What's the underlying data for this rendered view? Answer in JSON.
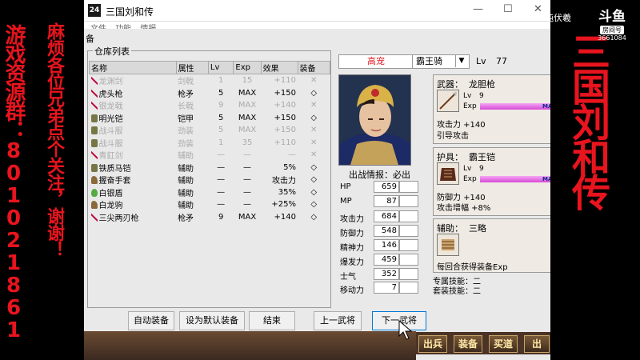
{
  "overlay": {
    "left_text_1": "游戏资源群：801021861",
    "left_text_2": "麻烦各位兄弟点个关注，谢谢！",
    "right_title": "三国刘和传",
    "streamer": "混沌伏羲",
    "logo_name": "斗鱼",
    "logo_tag": "房间号",
    "logo_room": "3661084"
  },
  "window": {
    "title": "三国刘和传",
    "icon_text": "24",
    "menu": [
      "文件",
      "功能",
      "情报"
    ],
    "section_label": "备"
  },
  "warehouse": {
    "title": "仓库列表",
    "columns": [
      "名称",
      "属性",
      "Lv",
      "Exp",
      "效果",
      "装备"
    ],
    "rows": [
      {
        "name": "龙渊剑",
        "attr": "剑戟",
        "lv": "1",
        "exp": "15",
        "eff": "+110",
        "eq": "✕",
        "dim": true,
        "icon": "sword-icon"
      },
      {
        "name": "虎头枪",
        "attr": "枪矛",
        "lv": "5",
        "exp": "MAX",
        "eff": "+150",
        "eq": "◇",
        "dim": false,
        "icon": "spear-icon"
      },
      {
        "name": "银龙戟",
        "attr": "长戟",
        "lv": "9",
        "exp": "MAX",
        "eff": "+140",
        "eq": "✕",
        "dim": true,
        "icon": "halberd-icon"
      },
      {
        "name": "明光铠",
        "attr": "铠甲",
        "lv": "5",
        "exp": "MAX",
        "eff": "+150",
        "eq": "◇",
        "dim": false,
        "icon": "armor-icon"
      },
      {
        "name": "战斗服",
        "attr": "劲装",
        "lv": "5",
        "exp": "MAX",
        "eff": "+150",
        "eq": "✕",
        "dim": true,
        "icon": "armor-icon"
      },
      {
        "name": "战斗服",
        "attr": "劲装",
        "lv": "1",
        "exp": "35",
        "eff": "+110",
        "eq": "✕",
        "dim": true,
        "icon": "armor-icon"
      },
      {
        "name": "青釭剑",
        "attr": "辅助",
        "lv": "—",
        "exp": "—",
        "eff": "—",
        "eq": "✕",
        "dim": true,
        "icon": "sword-icon"
      },
      {
        "name": "铁质马铠",
        "attr": "辅助",
        "lv": "—",
        "exp": "—",
        "eff": "5%",
        "eq": "◇",
        "dim": false,
        "icon": "horse-armor-icon"
      },
      {
        "name": "握奋手套",
        "attr": "辅助",
        "lv": "—",
        "exp": "—",
        "eff": "攻击力",
        "eq": "◇",
        "dim": false,
        "icon": "glove-icon"
      },
      {
        "name": "白银盾",
        "attr": "辅助",
        "lv": "—",
        "exp": "—",
        "eff": "35%",
        "eq": "◇",
        "dim": false,
        "icon": "shield-icon"
      },
      {
        "name": "白龙驹",
        "attr": "辅助",
        "lv": "—",
        "exp": "—",
        "eff": "+25%",
        "eq": "◇",
        "dim": false,
        "icon": "horse-icon"
      },
      {
        "name": "三尖两刃枪",
        "attr": "枪矛",
        "lv": "9",
        "exp": "MAX",
        "eff": "+140",
        "eq": "◇",
        "dim": false,
        "icon": "spear-icon"
      }
    ]
  },
  "buttons": {
    "auto_equip": "自动装备",
    "set_default": "设为默认装备",
    "finish": "结束",
    "prev_general": "上一武将",
    "next_general": "下一武将"
  },
  "hero": {
    "name": "高宠",
    "mount": "霸王骑",
    "lv_label": "Lv",
    "lv": "77",
    "battle_info": "出战情报：必出",
    "stats": [
      {
        "label": "HP",
        "value": "659"
      },
      {
        "label": "MP",
        "value": "87"
      },
      {
        "label": "攻击力",
        "value": "684"
      },
      {
        "label": "防御力",
        "value": "548"
      },
      {
        "label": "精神力",
        "value": "146"
      },
      {
        "label": "爆发力",
        "value": "459"
      },
      {
        "label": "士气",
        "value": "352"
      },
      {
        "label": "移动力",
        "value": "7"
      }
    ]
  },
  "weapon": {
    "label": "武器：",
    "name": "龙胆枪",
    "lv_label": "Lv",
    "lv": "9",
    "exp_label": "Exp",
    "exp_tag": "MA",
    "exp_fraction": 1.0,
    "effect": "攻击力 +140",
    "skill": "引导攻击"
  },
  "armor": {
    "label": "护具：",
    "name": "霸王铠",
    "lv_label": "Lv",
    "lv": "9",
    "exp_label": "Exp",
    "exp_tag": "MA",
    "exp_fraction": 1.0,
    "effect": "防御力 +140",
    "skill": "攻击增幅 +8%"
  },
  "aux": {
    "label": "辅助：",
    "name": "三略",
    "effect": "每回合获得装备Exp"
  },
  "special": {
    "exclusive_skill": "专属技能：二",
    "set_skill": "套装技能：二"
  },
  "commands": [
    "出兵",
    "装备",
    "买道",
    "出"
  ]
}
